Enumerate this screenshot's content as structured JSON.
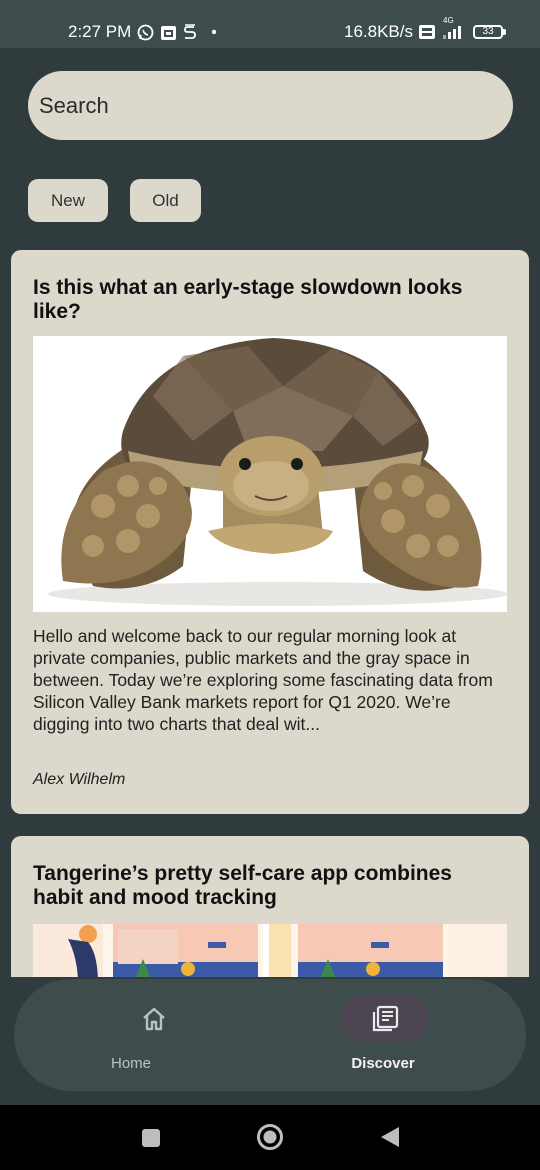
{
  "status_bar": {
    "time": "2:27 PM",
    "network_speed": "16.8KB/s",
    "network_type": "4G",
    "battery": "33",
    "icons": [
      "whatsapp-icon",
      "calendar-app-icon",
      "s-app-icon",
      "dot-icon",
      "volte-icon",
      "signal-icon",
      "battery-icon"
    ]
  },
  "search": {
    "placeholder": "Search"
  },
  "filters": {
    "new_label": "New",
    "old_label": "Old"
  },
  "articles": [
    {
      "title": "Is this what an early-stage slowdown looks like?",
      "image": "tortoise-photo",
      "excerpt": "Hello and welcome back to our regular morning look at private companies, public markets and the gray space in between. Today we’re exploring some fascinating data from Silicon Valley Bank markets report for Q1 2020. We’re digging into two charts that deal wit...",
      "author": "Alex Wilhelm"
    },
    {
      "title": "Tangerine’s pretty self-care app combines habit and mood tracking",
      "image": "app-screenshots-illustration"
    }
  ],
  "bottom_nav": {
    "items": [
      {
        "label": "Home",
        "icon": "home-icon",
        "selected": false
      },
      {
        "label": "Discover",
        "icon": "news-icon",
        "selected": true
      }
    ]
  },
  "system_nav": {
    "icons": [
      "recents-icon",
      "home-circle-icon",
      "back-icon"
    ]
  },
  "colors": {
    "background": "#2f3b3c",
    "surface": "#dcd8cc",
    "nav_bar": "#3f4c4c",
    "nav_selected_pill": "#4c4451"
  }
}
